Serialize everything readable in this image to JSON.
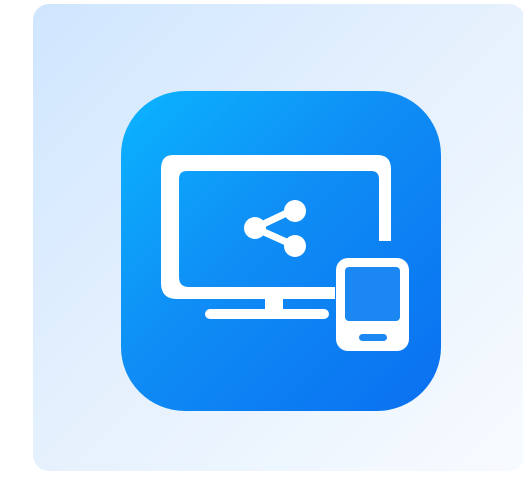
{
  "icon": {
    "name": "screen-share-to-phone",
    "glyphs": [
      "monitor-icon",
      "share-icon",
      "phone-icon"
    ]
  },
  "colors": {
    "card_start": "#cfe6ff",
    "card_end": "#f7fbff",
    "icon_start": "#0bb4ff",
    "icon_end": "#0a6ff0",
    "glyph": "#ffffff"
  }
}
